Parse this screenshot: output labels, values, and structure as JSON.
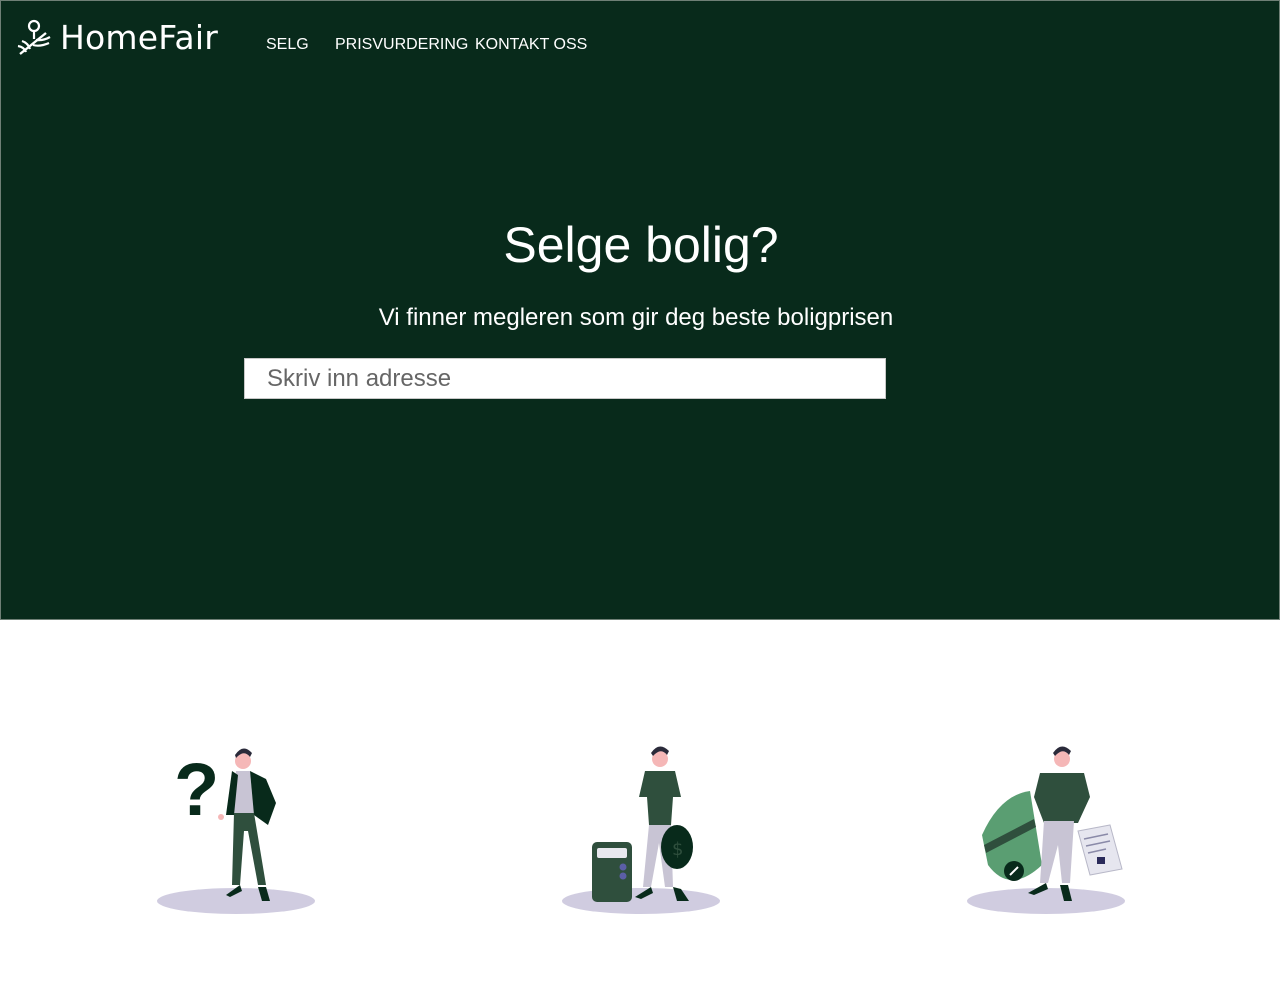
{
  "brand": {
    "name": "HomeFair"
  },
  "nav": {
    "items": [
      "SELG",
      "PRISVURDERING",
      "KONTAKT OSS"
    ]
  },
  "hero": {
    "title": "Selge bolig?",
    "subtitle": "Vi finner megleren som gir deg beste boligprisen"
  },
  "search": {
    "placeholder": "Skriv inn adresse",
    "value": ""
  },
  "illustrations": [
    {
      "icon": "person-question-icon"
    },
    {
      "icon": "person-calculator-coin-icon"
    },
    {
      "icon": "person-card-document-icon"
    }
  ],
  "colors": {
    "hero_bg": "#082a1b",
    "accent_green": "#2f4f3d",
    "light_green": "#5a9e72",
    "shadow": "#d0cce0",
    "skin": "#f5b7b7"
  }
}
